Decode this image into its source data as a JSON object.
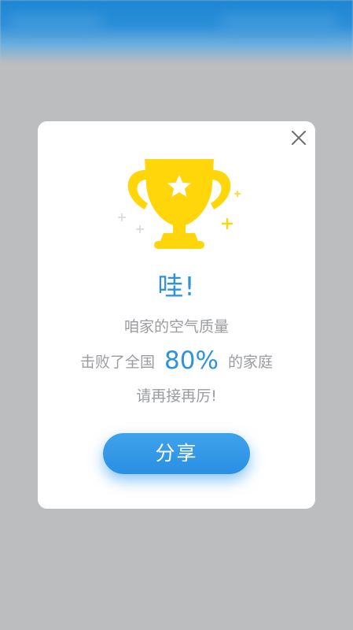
{
  "dialog": {
    "title": "哇!",
    "line1": "咱家的空气质量",
    "line2_prefix": "击败了全国",
    "percent": "80%",
    "line2_suffix": "的家庭",
    "line3": "请再接再厉!",
    "share_label": "分享"
  },
  "icons": {
    "close": "close-icon",
    "trophy": "trophy-icon",
    "star": "star-icon",
    "sparkle": "sparkle-icon"
  },
  "colors": {
    "accent": "#2e93d9",
    "trophy": "#ffd60a",
    "button": "#3399e8",
    "overlay": "#bbbdbf"
  }
}
